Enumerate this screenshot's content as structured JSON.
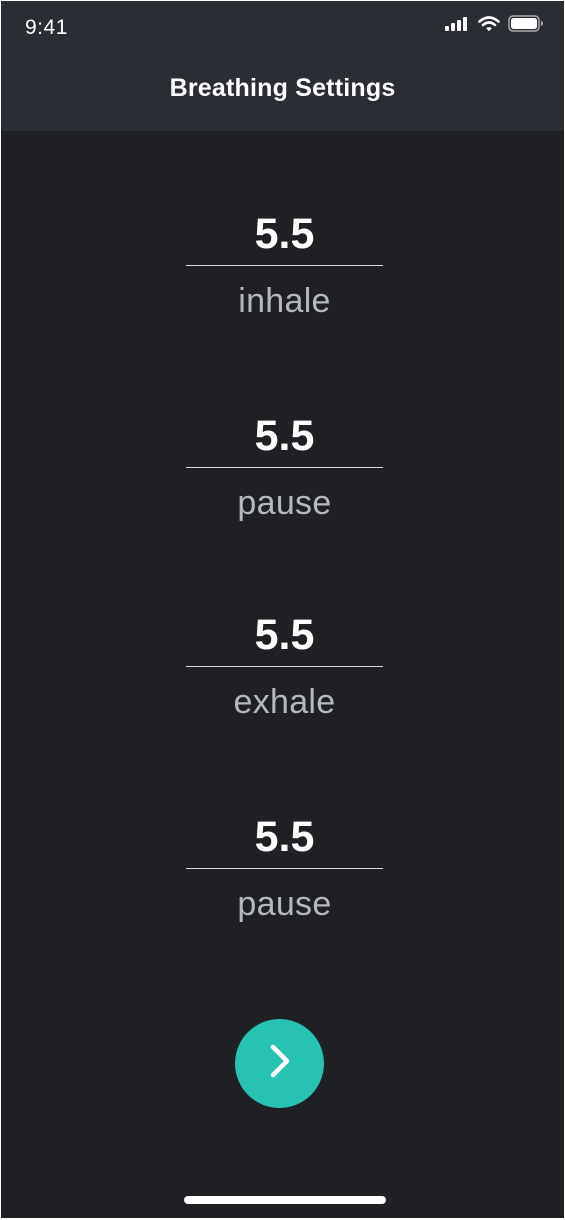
{
  "status_bar": {
    "time": "9:41",
    "icons": [
      "signal-icon",
      "wifi-icon",
      "battery-icon"
    ]
  },
  "nav": {
    "title": "Breathing Settings"
  },
  "fields": [
    {
      "value": "5.5",
      "label": "inhale"
    },
    {
      "value": "5.5",
      "label": "pause"
    },
    {
      "value": "5.5",
      "label": "exhale"
    },
    {
      "value": "5.5",
      "label": "pause"
    }
  ],
  "next_button": {
    "icon": "chevron-right-icon"
  },
  "colors": {
    "background": "#1e2024",
    "header": "#2a2d33",
    "accent": "#27c2b2",
    "label_text": "#b5b8bd"
  }
}
